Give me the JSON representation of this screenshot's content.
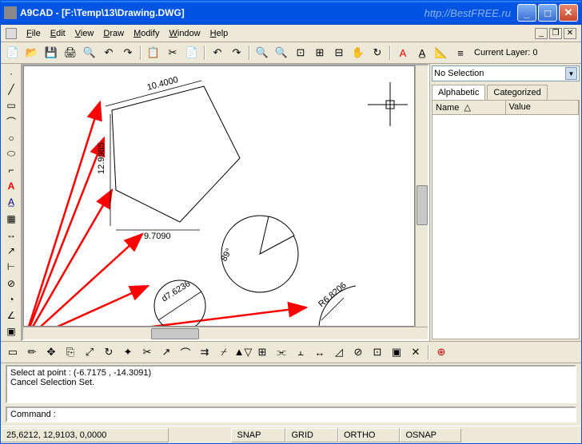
{
  "title": "A9CAD - [F:\\Temp\\13\\Drawing.DWG]",
  "watermark": "http://BestFREE.ru",
  "menu": {
    "file": "File",
    "edit": "Edit",
    "view": "View",
    "draw": "Draw",
    "modify": "Modify",
    "window": "Window",
    "help": "Help"
  },
  "layer_label": "Current Layer: 0",
  "right_panel": {
    "selection": "No Selection",
    "tab_alpha": "Alphabetic",
    "tab_cat": "Categorized",
    "col_name": "Name",
    "col_value": "Value"
  },
  "cmd_history": {
    "line1": "Select at point : (-6.7175 , -14.3091)",
    "line2": "Cancel Selection Set."
  },
  "cmd_prompt": "Command :",
  "status": {
    "coords": "25,6212, 12,9103, 0,0000",
    "snap": "SNAP",
    "grid": "GRID",
    "ortho": "ORTHO",
    "osnap": "OSNAP"
  },
  "drawing": {
    "dims": {
      "d1": "10.4000",
      "d2": "12.9985",
      "d3": "9.7090",
      "d4": "d7.6236",
      "d5": "R6.8206",
      "d6": "89°"
    }
  }
}
